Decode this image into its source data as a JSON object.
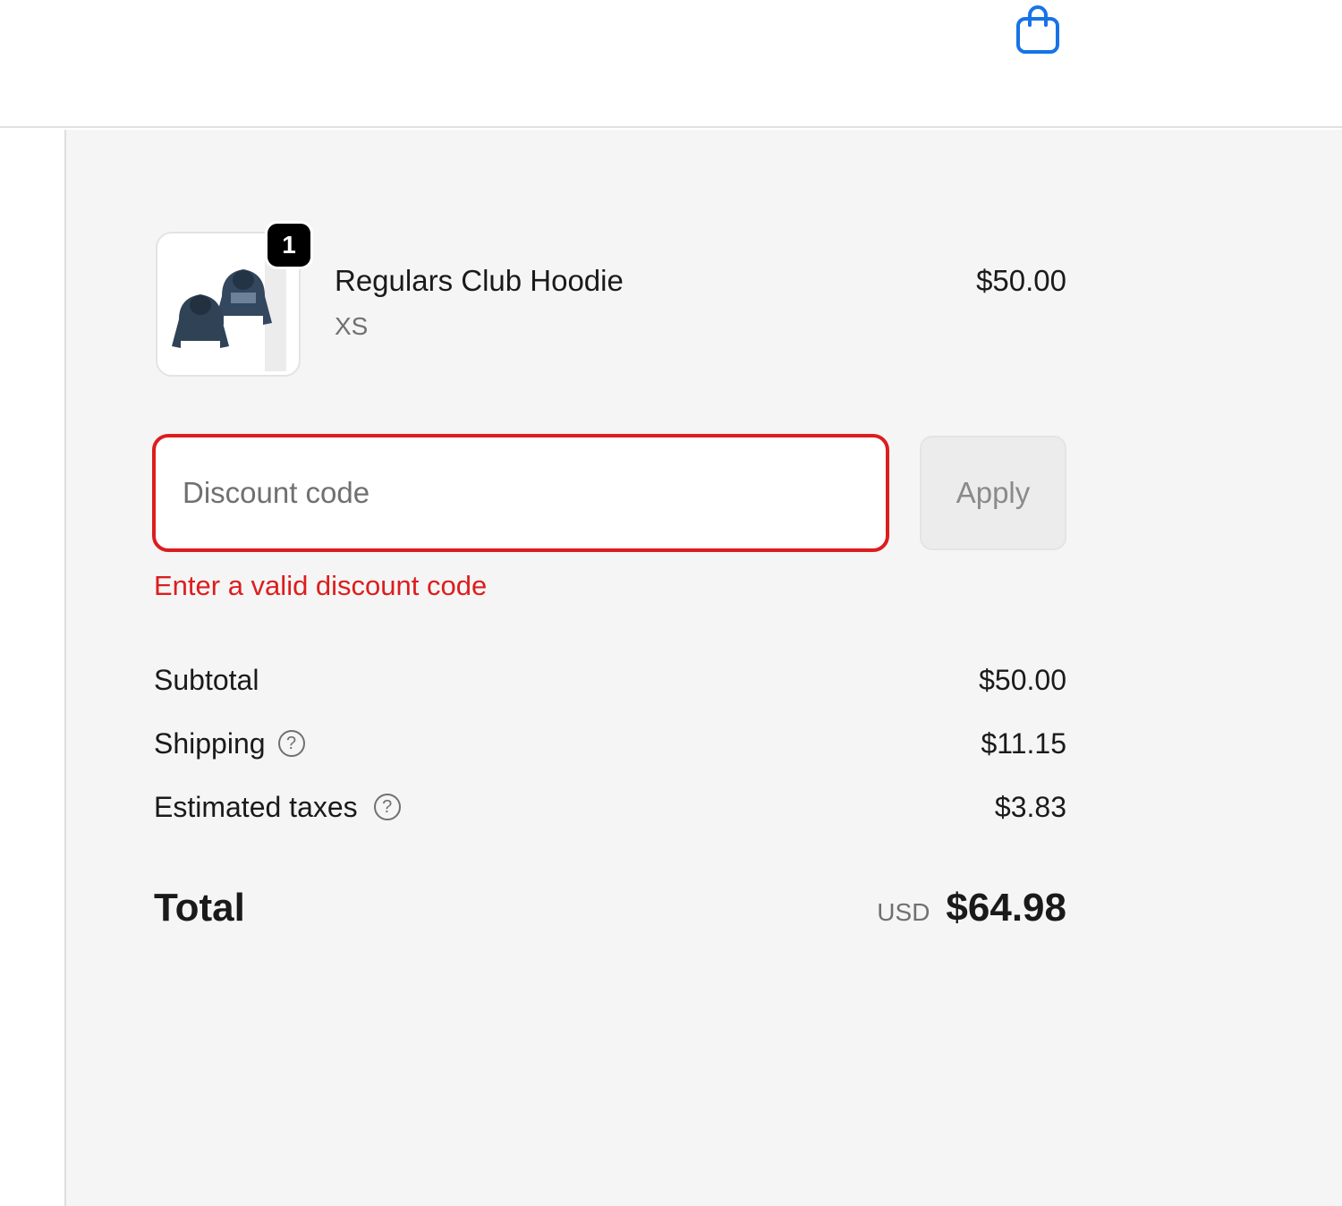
{
  "header": {
    "cart_icon": "shopping-bag-icon",
    "accent_color": "#1773e6"
  },
  "line_item": {
    "quantity": "1",
    "name": "Regulars Club Hoodie",
    "variant": "XS",
    "price": "$50.00",
    "image_icon": "hoodie-product-image"
  },
  "discount": {
    "placeholder": "Discount code",
    "value": "",
    "apply_label": "Apply",
    "error": "Enter a valid discount code",
    "error_color": "#dd1d1d"
  },
  "costs": {
    "subtotal_label": "Subtotal",
    "subtotal_value": "$50.00",
    "shipping_label": "Shipping",
    "shipping_value": "$11.15",
    "taxes_label": "Estimated taxes",
    "taxes_value": "$3.83",
    "help_icon": "question-circle-icon"
  },
  "total": {
    "label": "Total",
    "currency": "USD",
    "value": "$64.98"
  }
}
